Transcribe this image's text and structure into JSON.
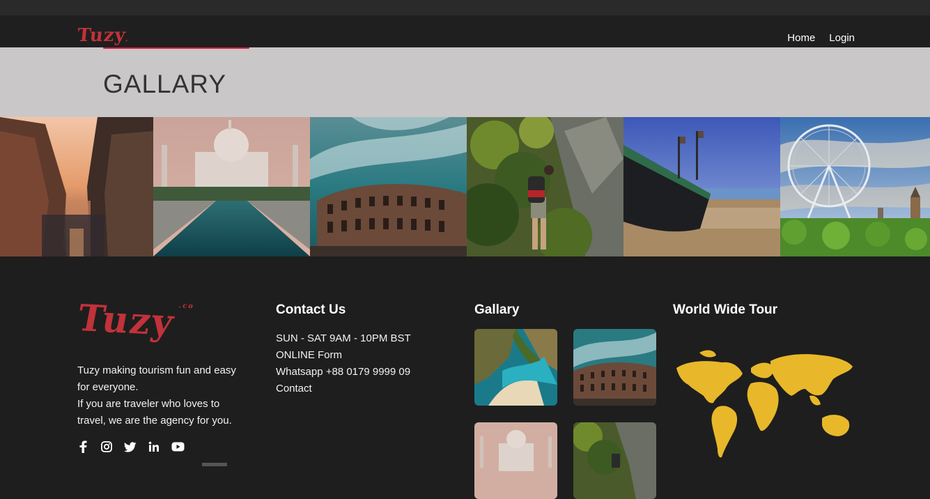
{
  "nav": {
    "logo": "Tuzy",
    "links": [
      "Home",
      "Login"
    ]
  },
  "hero": {
    "title": "GALLARY"
  },
  "footer": {
    "logo": "Tuzy",
    "logo_suffix": ".co",
    "description_lines": [
      "Tuzy making tourism fun and easy",
      "for everyone.",
      "If you are traveler who loves to",
      "travel, we are the agency for you."
    ],
    "socials": [
      "facebook-icon",
      "instagram-icon",
      "twitter-icon",
      "linkedin-icon",
      "youtube-icon"
    ],
    "contact": {
      "title": "Contact Us",
      "lines": [
        "SUN - SAT 9AM - 10PM BST",
        "ONLINE Form",
        "Whatsapp +88 0179 9999 09",
        "Contact"
      ]
    },
    "gallery": {
      "title": "Gallary"
    },
    "tour": {
      "title": "World Wide Tour"
    }
  },
  "colors": {
    "brand": "#c1323a",
    "accent_line": "#d81b3a",
    "hero_bg": "#c9c7c8",
    "footer_bg": "#1e1e1e",
    "map": "#e8b82a"
  }
}
